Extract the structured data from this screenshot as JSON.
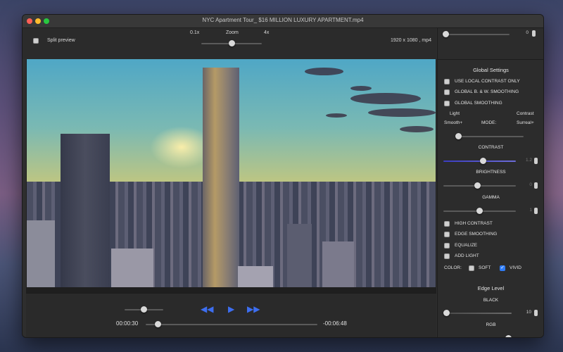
{
  "window": {
    "title": "NYC Apartment Tour_ $16 MILLION LUXURY APARTMENT.mp4"
  },
  "toolbar": {
    "split_preview_label": "Split preview",
    "zoom_min_label": "0.1x",
    "zoom_label": "Zoom",
    "zoom_max_label": "4x",
    "zoom_value_fraction": 0.5,
    "video_info": "1920 x 1080 , mp4"
  },
  "sidebar_top": {
    "value": "0"
  },
  "global_settings": {
    "title": "Global Settings",
    "options": [
      {
        "label": "USE LOCAL CONTRAST ONLY",
        "checked": false
      },
      {
        "label": "GLOBAL B. & W. SMOOTHING",
        "checked": false
      },
      {
        "label": "GLOBAL SMOOTHING",
        "checked": false
      }
    ],
    "mode": {
      "light_label": "Light",
      "contrast_label": "Contrast",
      "smooth_label": "Smooth+",
      "mode_label": "MODE:",
      "surreal_label": "Surreal+"
    },
    "contrast": {
      "label": "CONTRAST",
      "value": "1.2"
    },
    "brightness": {
      "label": "BRIGHTNESS",
      "value": "0"
    },
    "gamma": {
      "label": "GAMMA",
      "value": "1"
    },
    "extra_options": [
      {
        "label": "HIGH CONTRAST",
        "checked": false
      },
      {
        "label": "EDGE SMOOTHING",
        "checked": false
      },
      {
        "label": "EQUALIZE",
        "checked": false
      },
      {
        "label": "ADD LIGHT",
        "checked": false
      }
    ],
    "color": {
      "label": "COLOR:",
      "soft_label": "SOFT",
      "soft_checked": false,
      "vivid_label": "VIVID",
      "vivid_checked": true
    }
  },
  "edge_level": {
    "title": "Edge Level",
    "black": {
      "label": "BLACK",
      "value": "10"
    },
    "rgb": {
      "label": "RGB",
      "value": "10"
    }
  },
  "playback": {
    "current_time": "00:00:30",
    "remaining_time": "-00:06:48",
    "progress_fraction": 0.07,
    "volume_fraction": 0.5,
    "rewind_icon": "rewind-icon",
    "play_icon": "play-icon",
    "forward_icon": "fast-forward-icon",
    "accent_color": "#3d6ef0"
  }
}
